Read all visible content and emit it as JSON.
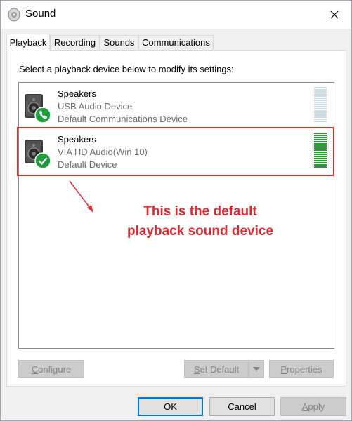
{
  "window": {
    "title": "Sound",
    "icons": {
      "title": "speaker-icon",
      "close": "close-icon"
    }
  },
  "tabs": [
    {
      "label": "Playback",
      "active": true
    },
    {
      "label": "Recording",
      "active": false
    },
    {
      "label": "Sounds",
      "active": false
    },
    {
      "label": "Communications",
      "active": false
    }
  ],
  "instruction": "Select a playback device below to modify its settings:",
  "devices": [
    {
      "name": "Speakers",
      "line2": "USB Audio Device",
      "line3": "Default Communications Device",
      "badge": "phone-icon",
      "meter_color": "#c8dcea"
    },
    {
      "name": "Speakers",
      "line2": "VIA HD Audio(Win 10)",
      "line3": "Default Device",
      "badge": "check-icon",
      "meter_color": "#1fa12e"
    }
  ],
  "annotation": {
    "line1": "This is the default",
    "line2": "playback sound device",
    "color": "#e0282e"
  },
  "buttons": {
    "configure": {
      "mnemonic": "C",
      "rest": "onfigure",
      "enabled": false
    },
    "set_default": {
      "mnemonic": "S",
      "rest": "et Default",
      "enabled": false
    },
    "properties": {
      "mnemonic": "P",
      "rest": "roperties",
      "enabled": false
    },
    "ok": "OK",
    "cancel": "Cancel",
    "apply": {
      "mnemonic": "A",
      "rest": "pply",
      "enabled": false
    }
  },
  "colors": {
    "accent": "#0078d7",
    "badge_green": "#1e9e3c"
  }
}
